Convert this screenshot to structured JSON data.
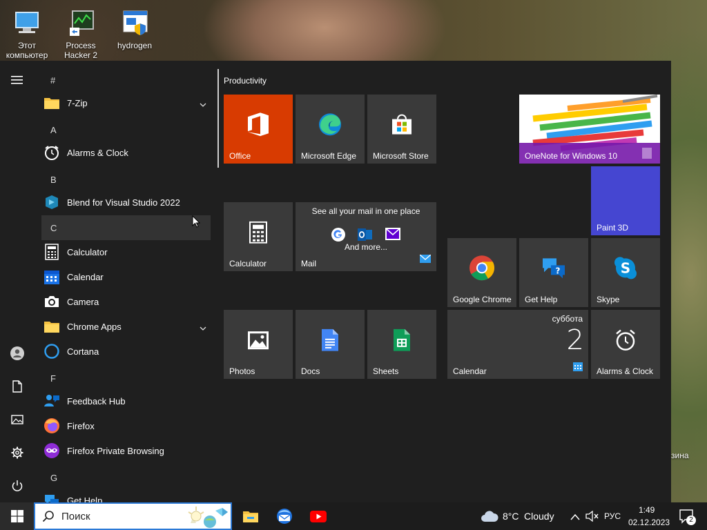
{
  "desktop": {
    "icons": [
      {
        "label": "Этот компьютер",
        "icon": "this-pc-icon"
      },
      {
        "label": "Process Hacker 2",
        "icon": "process-hacker-icon"
      },
      {
        "label": "hydrogen",
        "icon": "hydrogen-shortcut-icon"
      }
    ],
    "recycle_bin_label": "зина"
  },
  "start_menu": {
    "rail": {
      "menu": "hamburger-icon",
      "user": "user-icon",
      "documents": "document-icon",
      "pictures": "pictures-icon",
      "settings": "gear-icon",
      "power": "power-icon"
    },
    "app_list": {
      "sections": {
        "hash": "#",
        "a": "A",
        "b": "B",
        "c": "C",
        "f": "F",
        "g": "G"
      },
      "apps": {
        "zip": "7-Zip",
        "alarms": "Alarms & Clock",
        "blend": "Blend for Visual Studio 2022",
        "calculator": "Calculator",
        "calendar": "Calendar",
        "camera": "Camera",
        "chrome_apps": "Chrome Apps",
        "cortana": "Cortana",
        "feedback": "Feedback Hub",
        "firefox": "Firefox",
        "firefox_private": "Firefox Private Browsing",
        "get_help": "Get Help"
      }
    },
    "tiles": {
      "group_title": "Productivity",
      "office": "Office",
      "edge": "Microsoft Edge",
      "store": "Microsoft Store",
      "onenote": "OneNote for Windows 10",
      "paint3d": "Paint 3D",
      "calculator": "Calculator",
      "mail": {
        "label": "Mail",
        "headline": "See all your mail in one place",
        "more": "And more..."
      },
      "chrome": "Google Chrome",
      "get_help": "Get Help",
      "skype": "Skype",
      "photos": "Photos",
      "docs": "Docs",
      "sheets": "Sheets",
      "calendar": {
        "label": "Calendar",
        "day_name": "суббота",
        "day_number": "2"
      },
      "alarms": "Alarms & Clock"
    },
    "colors": {
      "office": "#d83b01",
      "paint3d": "#4546d1",
      "tile": "#3a3a3a",
      "menu_bg": "#1f1f1f"
    }
  },
  "taskbar": {
    "search_placeholder": "Поиск",
    "weather": {
      "temp": "8°C",
      "condition": "Cloudy"
    },
    "language": "РУС",
    "time": "1:49",
    "date": "02.12.2023",
    "notifications_count": "2",
    "pinned": [
      "file-explorer-icon",
      "thunderbird-icon",
      "youtube-icon"
    ]
  }
}
